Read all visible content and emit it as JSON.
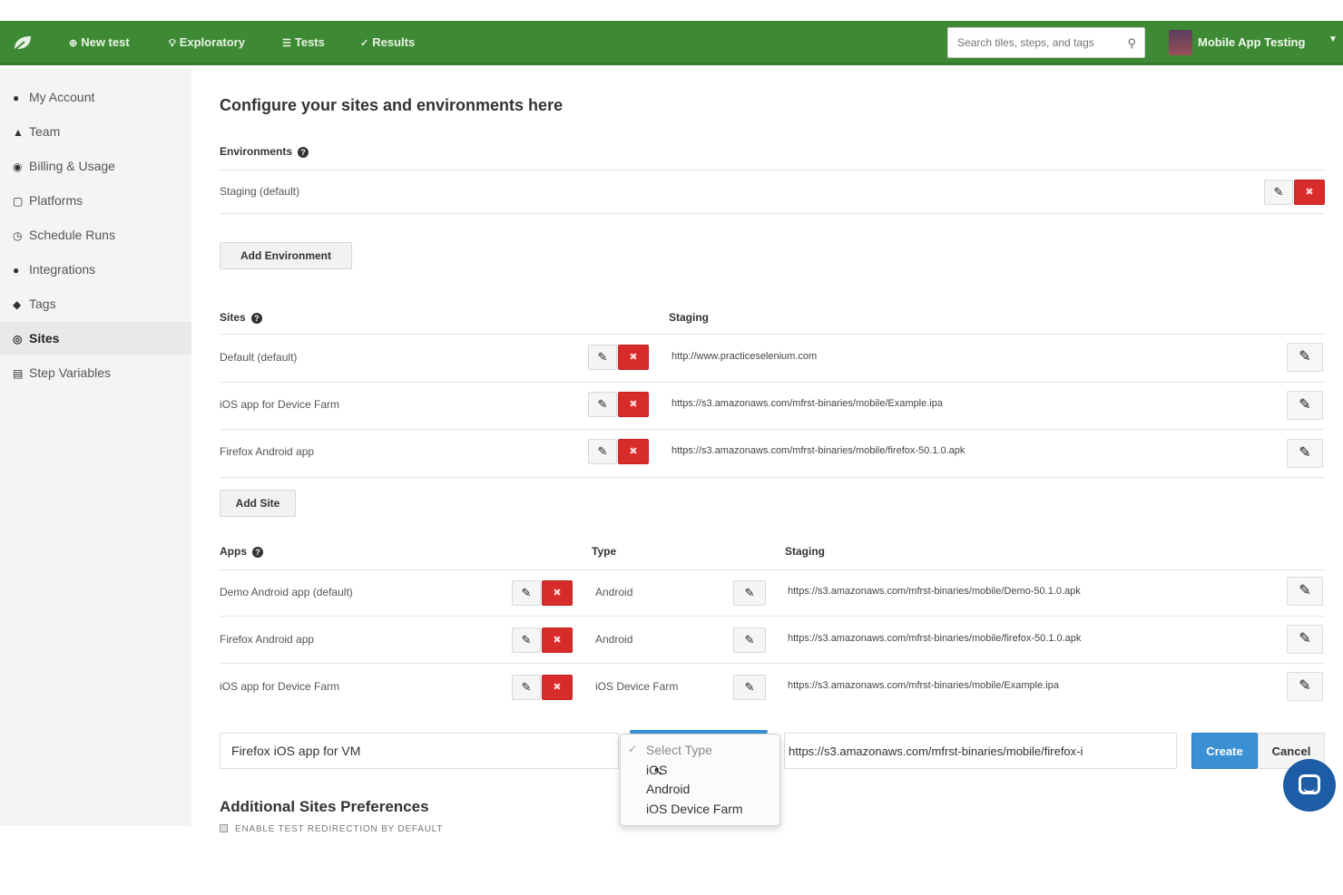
{
  "colors": {
    "topbar": "#3e8a34",
    "danger": "#d82b2b",
    "primary": "#3b8fd3",
    "sidebar": "#f4f4f4"
  },
  "topbar": {
    "logo_icon": "leaf-icon",
    "nav": [
      {
        "icon": "plus-circle-icon",
        "label": "New test"
      },
      {
        "icon": "lightbulb-icon",
        "label": "Exploratory"
      },
      {
        "icon": "list-icon",
        "label": "Tests"
      },
      {
        "icon": "check-circle-icon",
        "label": "Results"
      }
    ],
    "search_placeholder": "Search tiles, steps, and tags",
    "user": "Mobile App Testing"
  },
  "sidebar": {
    "items": [
      {
        "icon": "user-icon",
        "label": "My Account"
      },
      {
        "icon": "team-icon",
        "label": "Team"
      },
      {
        "icon": "billing-icon",
        "label": "Billing & Usage"
      },
      {
        "icon": "monitor-icon",
        "label": "Platforms"
      },
      {
        "icon": "clock-icon",
        "label": "Schedule Runs"
      },
      {
        "icon": "puzzle-icon",
        "label": "Integrations"
      },
      {
        "icon": "tag-icon",
        "label": "Tags"
      },
      {
        "icon": "globe-icon",
        "label": "Sites"
      },
      {
        "icon": "table-icon",
        "label": "Step Variables"
      }
    ],
    "active": "Sites"
  },
  "main": {
    "title": "Configure your sites and environments here",
    "environments": {
      "heading": "Environments",
      "rows": [
        {
          "name": "Staging",
          "tag": "(default)"
        }
      ],
      "add_label": "Add Environment"
    },
    "sites": {
      "heading": "Sites",
      "col_staging": "Staging",
      "rows": [
        {
          "name": "Default",
          "tag": "(default)",
          "url": "http://www.practiceselenium.com"
        },
        {
          "name": "iOS app for Device Farm",
          "tag": "",
          "url": "https://s3.amazonaws.com/mfrst-binaries/mobile/Example.ipa"
        },
        {
          "name": "Firefox Android app",
          "tag": "",
          "url": "https://s3.amazonaws.com/mfrst-binaries/mobile/firefox-50.1.0.apk"
        }
      ],
      "add_label": "Add Site"
    },
    "apps": {
      "heading": "Apps",
      "col_type": "Type",
      "col_staging": "Staging",
      "rows": [
        {
          "name": "Demo Android app",
          "tag": "(default)",
          "type": "Android",
          "url": "https://s3.amazonaws.com/mfrst-binaries/mobile/Demo-50.1.0.apk"
        },
        {
          "name": "Firefox Android app",
          "tag": "",
          "type": "Android",
          "url": "https://s3.amazonaws.com/mfrst-binaries/mobile/firefox-50.1.0.apk"
        },
        {
          "name": "iOS app for Device Farm",
          "tag": "",
          "type": "iOS Device Farm",
          "url": "https://s3.amazonaws.com/mfrst-binaries/mobile/Example.ipa"
        }
      ],
      "new_row": {
        "name_value": "Firefox iOS app for VM",
        "url_value": "https://s3.amazonaws.com/mfrst-binaries/mobile/firefox-i",
        "create_label": "Create",
        "cancel_label": "Cancel",
        "type_options": [
          "Select Type",
          "iOS",
          "Android",
          "iOS Device Farm"
        ],
        "type_selected": "Select Type"
      }
    },
    "preferences": {
      "heading": "Additional Sites Preferences",
      "checkbox_label": "ENABLE TEST REDIRECTION BY DEFAULT"
    }
  }
}
